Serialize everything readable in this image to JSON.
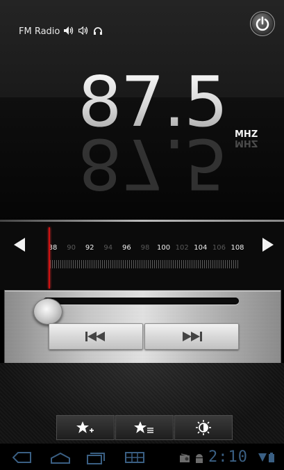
{
  "app": {
    "title": "FM Radio",
    "status_icons": [
      "speaker-icon",
      "speaker-outline-icon",
      "headphones-icon"
    ]
  },
  "display": {
    "frequency": "87.5",
    "unit": "MHZ"
  },
  "tuner": {
    "scale": [
      {
        "label": "88",
        "major": true
      },
      {
        "label": "90",
        "major": false
      },
      {
        "label": "92",
        "major": true
      },
      {
        "label": "94",
        "major": false
      },
      {
        "label": "96",
        "major": true
      },
      {
        "label": "98",
        "major": false
      },
      {
        "label": "100",
        "major": true
      },
      {
        "label": "102",
        "major": false
      },
      {
        "label": "104",
        "major": true
      },
      {
        "label": "106",
        "major": false
      },
      {
        "label": "108",
        "major": true
      }
    ],
    "position_fraction": 0
  },
  "controls": {
    "prev_icon": "skip-previous-icon",
    "next_icon": "skip-next-icon"
  },
  "bottom_buttons": [
    "add-favorite-icon",
    "favorites-list-icon",
    "brightness-icon"
  ],
  "system_bar": {
    "clock": "2:10",
    "accent": "#3a5f83"
  }
}
